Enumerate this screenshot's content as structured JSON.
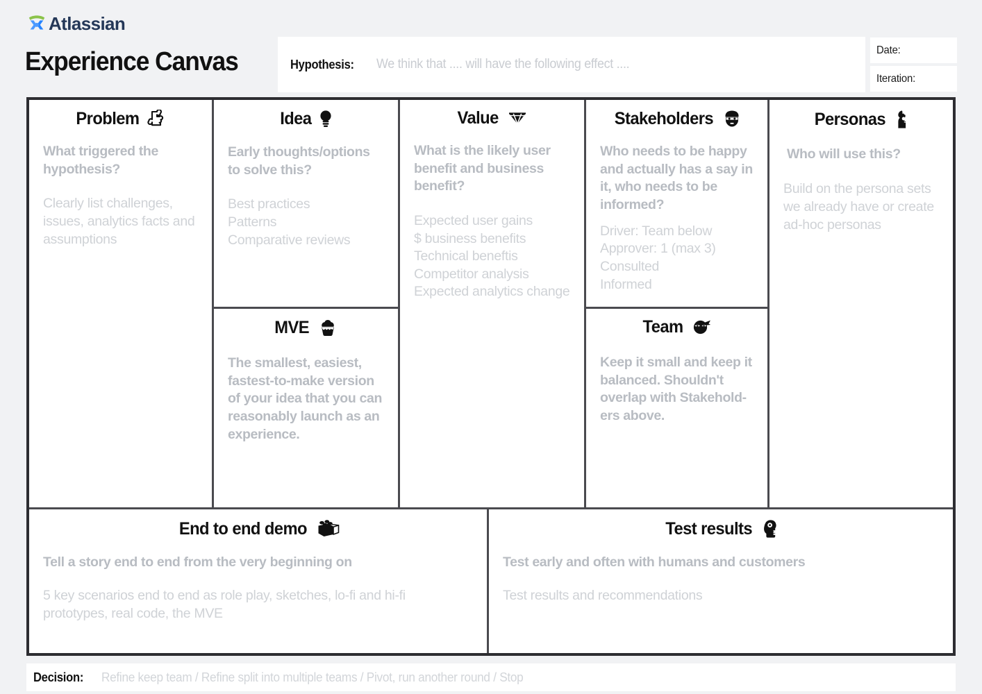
{
  "brand": {
    "name": "Atlassian",
    "logo_green": "#8bc34a",
    "logo_blue": "#2684ff",
    "logo_navy": "#253858"
  },
  "header": {
    "title": "Experience Canvas",
    "hypothesis_label": "Hypothesis:",
    "hypothesis_placeholder": "We think that .... will have the following effect ....",
    "date_label": "Date:",
    "iteration_label": "Iteration:"
  },
  "cells": {
    "problem": {
      "title": "Problem",
      "icon": "puzzle-piece-icon",
      "lead": "What triggered the hypothesis?",
      "body": "Clearly list challenges, issues, analytics facts and assumptions"
    },
    "idea": {
      "title": "Idea",
      "icon": "light-bulb-icon",
      "lead": "Early thoughts/options to solve this?",
      "body": "Best practices\nPatterns\nComparative reviews"
    },
    "mve": {
      "title": "MVE",
      "icon": "cupcake-icon",
      "lead": "",
      "body": "The smallest, easiest, fastest-to-make version of your idea that you can reasonably launch as an experience."
    },
    "value": {
      "title": "Value",
      "icon": "diamond-icon",
      "lead": "What is the likely user benefit and business benefit?",
      "body": "Expected user gains\n$ business benefits\nTechnical beneftis\nCompetitor analysis\nExpected analytics change"
    },
    "stakeholders": {
      "title": "Stakeholders",
      "icon": "bearded-face-icon",
      "lead": "Who needs to be happy and actually has a say in it, who needs to be informed?",
      "body": "Driver: Team below\nApprover: 1 (max 3)\nConsulted\nInformed"
    },
    "team": {
      "title": "Team",
      "icon": "ninja-icon",
      "lead": "",
      "body": "Keep it small and keep it balanced. Shouldn't overlap with Stakehold-ers above."
    },
    "personas": {
      "title": "Personas",
      "icon": "person-bust-icon",
      "lead": "Who will use this?",
      "body": "Build on the persona sets we already have or create ad-hoc personas"
    },
    "end_to_end_demo": {
      "title": "End to end demo",
      "icon": "lego-brick-icon",
      "lead": "Tell a story end to end from the very beginning on",
      "body": "5 key scenarios end to end as role play, sketches, lo-fi and hi-fi prototypes, real code, the MVE"
    },
    "test_results": {
      "title": "Test results",
      "icon": "head-profile-icon",
      "lead": "Test early and often with humans and customers",
      "body": "Test results and recommendations"
    }
  },
  "footer": {
    "decision_label": "Decision:",
    "decision_text": "Refine keep team / Refine split into multiple teams / Pivot, run another round / Stop"
  }
}
